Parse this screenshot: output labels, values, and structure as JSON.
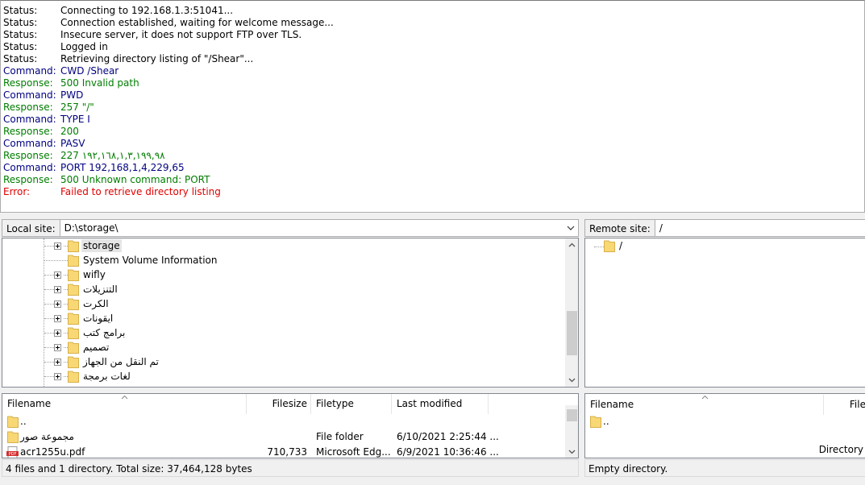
{
  "log": [
    {
      "type": "Status:",
      "msg": "Connecting to 192.168.1.3:51041...",
      "kind": "status"
    },
    {
      "type": "Status:",
      "msg": "Connection established, waiting for welcome message...",
      "kind": "status"
    },
    {
      "type": "Status:",
      "msg": "Insecure server, it does not support FTP over TLS.",
      "kind": "status"
    },
    {
      "type": "Status:",
      "msg": "Logged in",
      "kind": "status"
    },
    {
      "type": "Status:",
      "msg": "Retrieving directory listing of \"/Shear\"...",
      "kind": "status"
    },
    {
      "type": "Command:",
      "msg": "CWD /Shear",
      "kind": "command"
    },
    {
      "type": "Response:",
      "msg": "500 Invalid path",
      "kind": "response"
    },
    {
      "type": "Command:",
      "msg": "PWD",
      "kind": "command"
    },
    {
      "type": "Response:",
      "msg": "257 \"/\"",
      "kind": "response"
    },
    {
      "type": "Command:",
      "msg": "TYPE I",
      "kind": "command"
    },
    {
      "type": "Response:",
      "msg": "200",
      "kind": "response"
    },
    {
      "type": "Command:",
      "msg": "PASV",
      "kind": "command"
    },
    {
      "type": "Response:",
      "msg": "227 ١٩٢,١٦٨,١,٣,١٩٩,٩٨",
      "kind": "response"
    },
    {
      "type": "Command:",
      "msg": "PORT 192,168,1,4,229,65",
      "kind": "command"
    },
    {
      "type": "Response:",
      "msg": "500 Unknown command: PORT",
      "kind": "response"
    },
    {
      "type": "Error:",
      "msg": "Failed to retrieve directory listing",
      "kind": "error"
    }
  ],
  "local": {
    "label": "Local site:",
    "path": "D:\\storage\\",
    "tree": [
      {
        "name": "storage",
        "expander": true,
        "selected": true
      },
      {
        "name": "System Volume Information",
        "expander": false,
        "selected": false
      },
      {
        "name": "wifly",
        "expander": true,
        "selected": false
      },
      {
        "name": "التنزيلات",
        "expander": true,
        "selected": false
      },
      {
        "name": "الكرت",
        "expander": true,
        "selected": false
      },
      {
        "name": "ايقونات",
        "expander": true,
        "selected": false
      },
      {
        "name": "برامج كتب",
        "expander": true,
        "selected": false
      },
      {
        "name": "تصميم",
        "expander": true,
        "selected": false
      },
      {
        "name": "تم النقل من الجهاز",
        "expander": true,
        "selected": false
      },
      {
        "name": "لغات برمجة",
        "expander": true,
        "selected": false
      }
    ],
    "columns": {
      "filename": "Filename",
      "filesize": "Filesize",
      "filetype": "Filetype",
      "modified": "Last modified"
    },
    "files": [
      {
        "name": "..",
        "size": "",
        "type": "",
        "modified": "",
        "icon": "folder-icon"
      },
      {
        "name": "مجموعة صور",
        "size": "",
        "type": "File folder",
        "modified": "6/10/2021 2:25:44 ...",
        "icon": "folder-icon"
      },
      {
        "name": "acr1255u.pdf",
        "size": "710,733",
        "type": "Microsoft Edg...",
        "modified": "6/9/2021 10:36:46 ...",
        "icon": "pdf-icon"
      }
    ],
    "status": "4 files and 1 directory. Total size: 37,464,128 bytes"
  },
  "remote": {
    "label": "Remote site:",
    "path": "/",
    "tree": [
      {
        "name": "/"
      }
    ],
    "columns": {
      "filename": "Filename",
      "filesize": "File"
    },
    "files": [
      {
        "name": "..",
        "type_tail": "Directory"
      }
    ],
    "status": "Empty directory."
  },
  "colors": {
    "status": "#000000",
    "command": "#000080",
    "response": "#007d00",
    "error": "#e00000",
    "folder": "#f8d775"
  }
}
